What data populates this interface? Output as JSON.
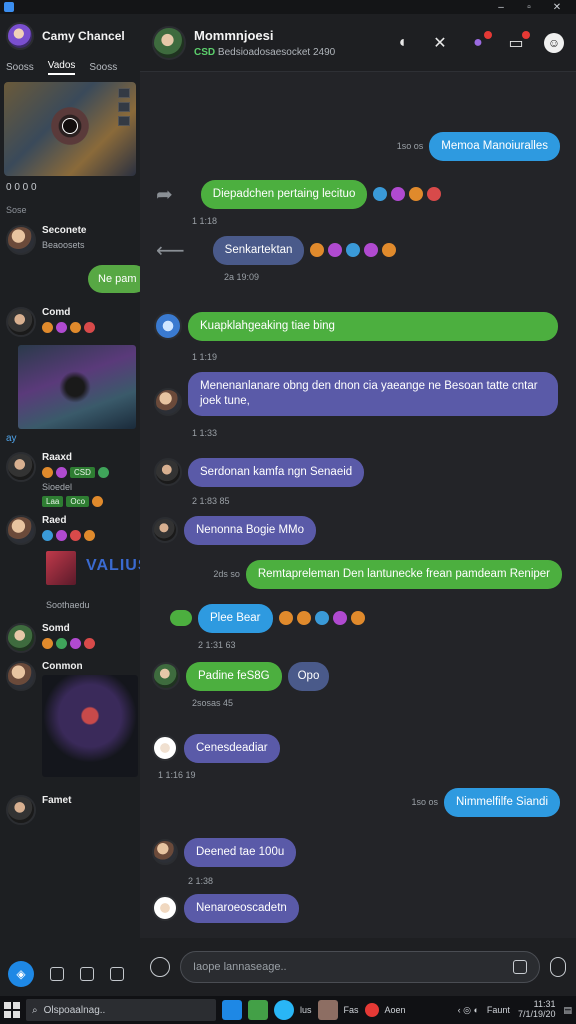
{
  "window": {
    "title": "Camy Chancel"
  },
  "sidebar": {
    "title": "Camy Chancel",
    "tabs": [
      "Sooss",
      "Vados",
      "Sooss"
    ],
    "section_label": "Sose",
    "conversations": [
      {
        "name": "Seconete",
        "sub": "Beaoosets"
      },
      {
        "name": "Comd",
        "sub": ""
      },
      {
        "name": "Raaxd",
        "sub": "Sioedel"
      },
      {
        "name": "Raed",
        "sub": "Soothaedu"
      },
      {
        "name": "Somd",
        "sub": ""
      },
      {
        "name": "Conmon",
        "sub": ""
      },
      {
        "name": "Famet",
        "sub": ""
      }
    ],
    "bubble_text": "Ne pam",
    "row_icons_text": "0 0 0 0",
    "art_title": "VALIUS",
    "link_text": "ay"
  },
  "chat": {
    "title": "Mommnjoesi",
    "subtitle_tag": "CSD",
    "subtitle": "Bedsioadosaesocket 2490",
    "messages": [
      {
        "text": "Memoa Manoiuralles",
        "stamp": "1so os"
      },
      {
        "text": "Diepadchen pertaing lecituo",
        "stamp": "1 1:18"
      },
      {
        "text": "Senkartektan",
        "stamp": "2a 19:09"
      },
      {
        "text": "Kuapklahgeaking tiae bing",
        "stamp": "1 1:19"
      },
      {
        "text": "Menenanlanare obng den dnon cia yaeange ne Besoan tatte cntar joek tune,",
        "stamp": "1 1:33"
      },
      {
        "text": "Serdonan kamfa ngn Senaeid",
        "stamp": "2 1:83 85"
      },
      {
        "text": "Nenonna Bogie MMo",
        "stamp": ""
      },
      {
        "text": "Remtapreleman Den lantunecke frean pamdeam Reniper",
        "stamp": "2ds so"
      },
      {
        "text": "Plee Bear",
        "stamp": "2 1:31 63"
      },
      {
        "text": "Padine feS8G",
        "stamp": "2sosas 45"
      },
      {
        "text": "Opo",
        "stamp": ""
      },
      {
        "text": "Cenesdeadiar",
        "stamp": "1 1:16 19"
      },
      {
        "text": "Nimmelfilfe Siandi",
        "stamp": "1so os"
      },
      {
        "text": "Deened tae 100u",
        "stamp": "2 1:38"
      },
      {
        "text": "Nenaroeoscadetn",
        "stamp": ""
      }
    ],
    "composer_placeholder": "Iaope lannaseage.."
  },
  "taskbar": {
    "search_text": "Olspoaalnag..",
    "apps": [
      "lus",
      "Fas",
      "Aoen"
    ],
    "time": "11:31",
    "date": "7/1/19/20",
    "tray_text": "Faunt"
  },
  "colors": {
    "green_bubble": "#4caf3f",
    "blue_bubble": "#2e9ae0",
    "purple_bubble": "#5a5aa8",
    "background": "#232428",
    "accent": "#1e88e5"
  },
  "icons": {
    "header": [
      "speaker-icon",
      "close-icon",
      "bubbles-icon",
      "notification-icon",
      "profile-icon"
    ],
    "composer": [
      "add-icon",
      "emoji-icon",
      "mic-icon"
    ]
  }
}
